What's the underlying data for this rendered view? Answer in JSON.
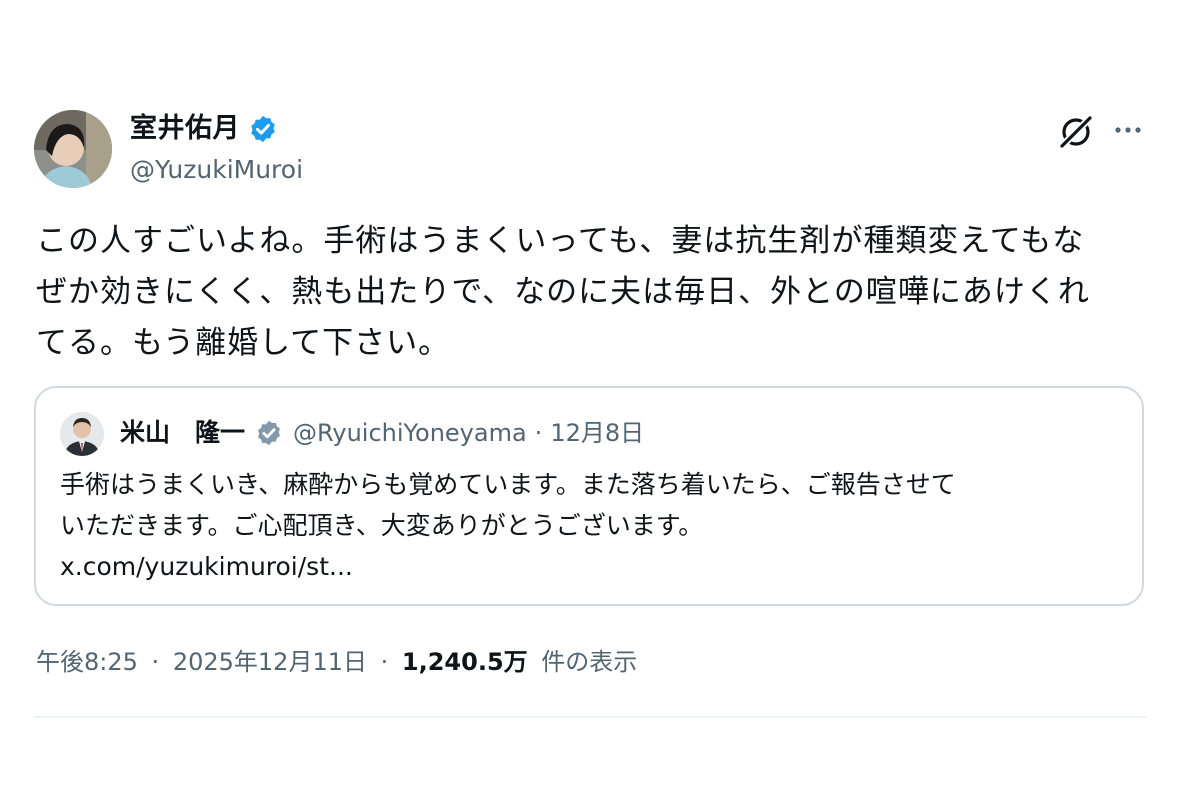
{
  "author": {
    "display_name": "室井佑月",
    "handle": "@YuzukiMuroi",
    "verified": true
  },
  "header_icons": [
    "grok-icon",
    "more-options-icon"
  ],
  "tweet": {
    "text": "この人すごいよね。手術はうまくいっても、妻は抗生剤が種類変えてもな\nぜか効きにくく、熱も出たりで、なのに夫は毎日、外との喧嘩にあけくれ\nてる。もう離婚して下さい。"
  },
  "quoted_tweet": {
    "display_name": "米山　隆一",
    "handle": "@RyuichiYoneyama",
    "separator": "·",
    "date": "12月8日",
    "text": "手術はうまくいき、麻酔からも覚めています。また落ち着いたら、ご報告させて\nいただきます。ご心配頂き、大変ありがとうございます。\nx.com/yuzukimuroi/st..."
  },
  "meta": {
    "time": "午後8:25",
    "sep1": "·",
    "date": "2025年12月11日",
    "sep2": "·",
    "views": "1,240.5万",
    "views_label": "件の表示"
  },
  "colors": {
    "text": "#0f1419",
    "secondary": "#536471",
    "verified": "#1d9bf0",
    "border": "#cfd9de"
  }
}
